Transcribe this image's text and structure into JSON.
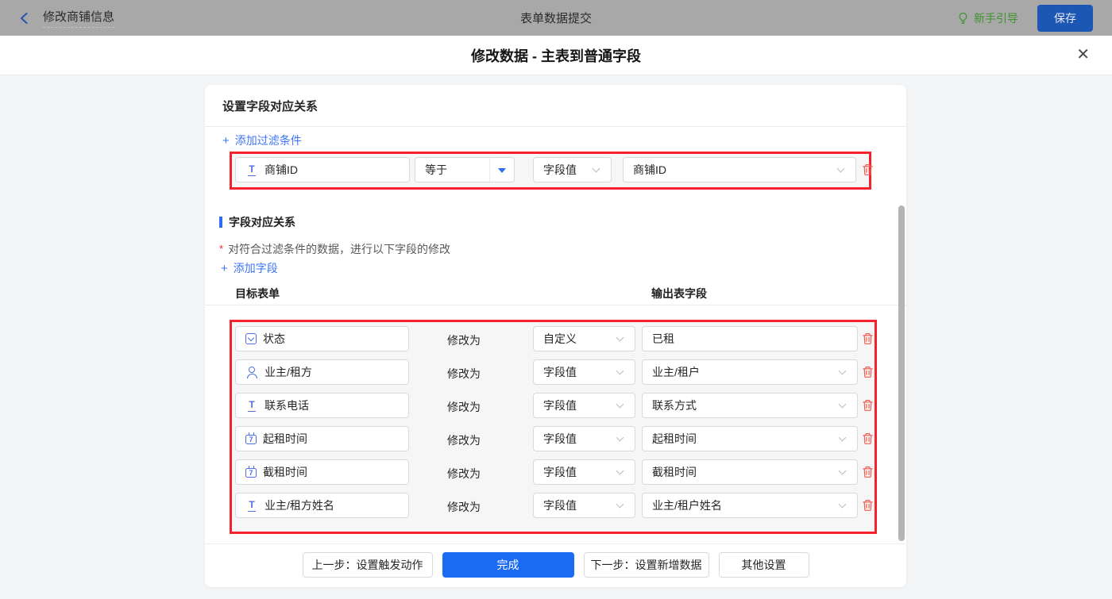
{
  "topbar": {
    "back_label": "修改商铺信息",
    "center_title": "表单数据提交",
    "guide_label": "新手引导",
    "save_label": "保存"
  },
  "modal": {
    "title": "修改数据 - 主表到普通字段"
  },
  "icons": {
    "close": "✕",
    "plus": "+"
  },
  "panel": {
    "header": "设置字段对应关系",
    "add_filter_label": "添加过滤条件",
    "filter": {
      "field": "商铺ID",
      "field_icon": "text-field-icon",
      "operator": "等于",
      "value_type": "字段值",
      "value_field": "商铺ID"
    },
    "mapping": {
      "section_title": "字段对应关系",
      "required_mark": "*",
      "description": "对符合过滤条件的数据，进行以下字段的修改",
      "add_field_label": "添加字段",
      "col_target": "目标表单",
      "col_output": "输出表字段",
      "modify_label": "修改为",
      "rows": [
        {
          "target": "状态",
          "icon": "select-field-icon",
          "method": "自定义",
          "output": "已租",
          "output_type": "input"
        },
        {
          "target": "业主/租方",
          "icon": "person-field-icon",
          "method": "字段值",
          "output": "业主/租户",
          "output_type": "select"
        },
        {
          "target": "联系电话",
          "icon": "text-field-icon",
          "method": "字段值",
          "output": "联系方式",
          "output_type": "select"
        },
        {
          "target": "起租时间",
          "icon": "date-field-icon",
          "method": "字段值",
          "output": "起租时间",
          "output_type": "select"
        },
        {
          "target": "截租时间",
          "icon": "date-field-icon",
          "method": "字段值",
          "output": "截租时间",
          "output_type": "select"
        },
        {
          "target": "业主/租方姓名",
          "icon": "text-field-icon",
          "method": "字段值",
          "output": "业主/租户姓名",
          "output_type": "select"
        }
      ]
    },
    "footer": {
      "prev_label": "上一步：设置触发动作",
      "done_label": "完成",
      "next_label": "下一步：设置新增数据",
      "other_label": "其他设置"
    }
  },
  "colors": {
    "primary_blue": "#1a6af2",
    "link_blue": "#3d74f8",
    "highlight_red": "#f5222d",
    "guide_green": "#3f9330",
    "trash_red": "#f15b50",
    "field_icon_blue": "#4d6fe3",
    "topbar_dimmed_gray": "#a8a8a8"
  }
}
